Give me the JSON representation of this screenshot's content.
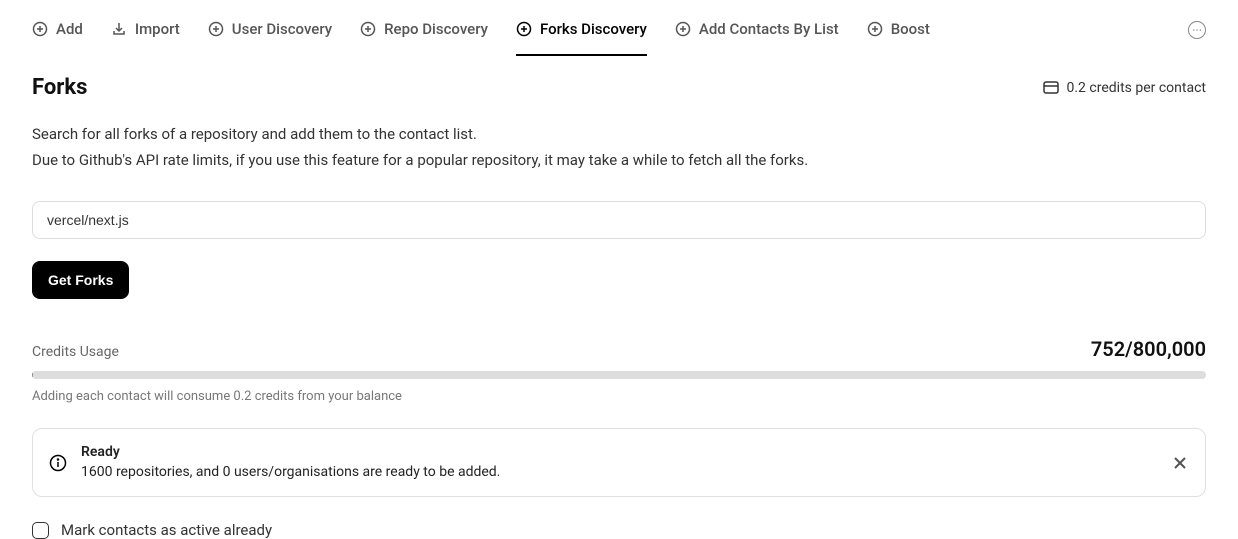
{
  "tabs": [
    {
      "label": "Add",
      "icon": "plus-circle"
    },
    {
      "label": "Import",
      "icon": "download"
    },
    {
      "label": "User Discovery",
      "icon": "plus-circle"
    },
    {
      "label": "Repo Discovery",
      "icon": "plus-circle"
    },
    {
      "label": "Forks Discovery",
      "icon": "plus-circle",
      "active": true
    },
    {
      "label": "Add Contacts By List",
      "icon": "plus-circle"
    },
    {
      "label": "Boost",
      "icon": "plus-circle"
    }
  ],
  "header": {
    "title": "Forks",
    "credits_per_contact": "0.2 credits per contact"
  },
  "description": {
    "line1": "Search for all forks of a repository and add them to the contact list.",
    "line2": "Due to Github's API rate limits, if you use this feature for a popular repository, it may take a while to fetch all the forks."
  },
  "input": {
    "value": "vercel/next.js",
    "placeholder": ""
  },
  "buttons": {
    "get_forks": "Get Forks"
  },
  "credits": {
    "label": "Credits Usage",
    "used": 752,
    "total": 800000,
    "display": "752/800,000",
    "note": "Adding each contact will consume 0.2 credits from your balance"
  },
  "alert": {
    "title": "Ready",
    "message": "1600 repositories, and 0 users/organisations are ready to be added."
  },
  "checkbox": {
    "label": "Mark contacts as active already",
    "checked": false
  }
}
